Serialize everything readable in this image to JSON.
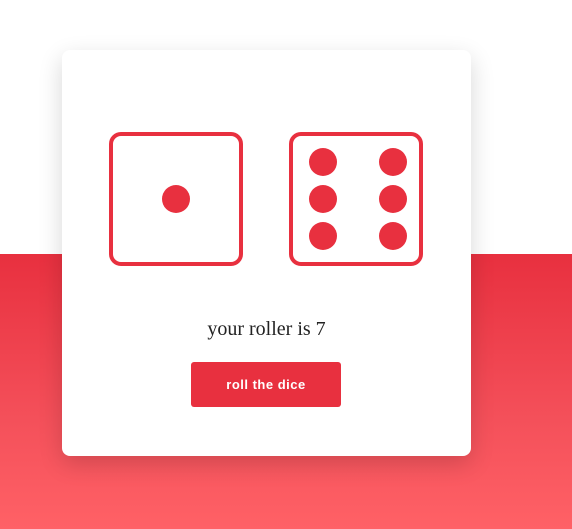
{
  "dice": {
    "left": {
      "value": 1
    },
    "right": {
      "value": 6
    }
  },
  "result": {
    "text": "your roller is 7"
  },
  "roll_button": {
    "label": "roll the dice"
  },
  "colors": {
    "accent": "#e8303f",
    "background_top": "#ffffff",
    "background_band_top": "#e8303f",
    "background_band_bottom": "#ff6166",
    "card": "#ffffff"
  }
}
